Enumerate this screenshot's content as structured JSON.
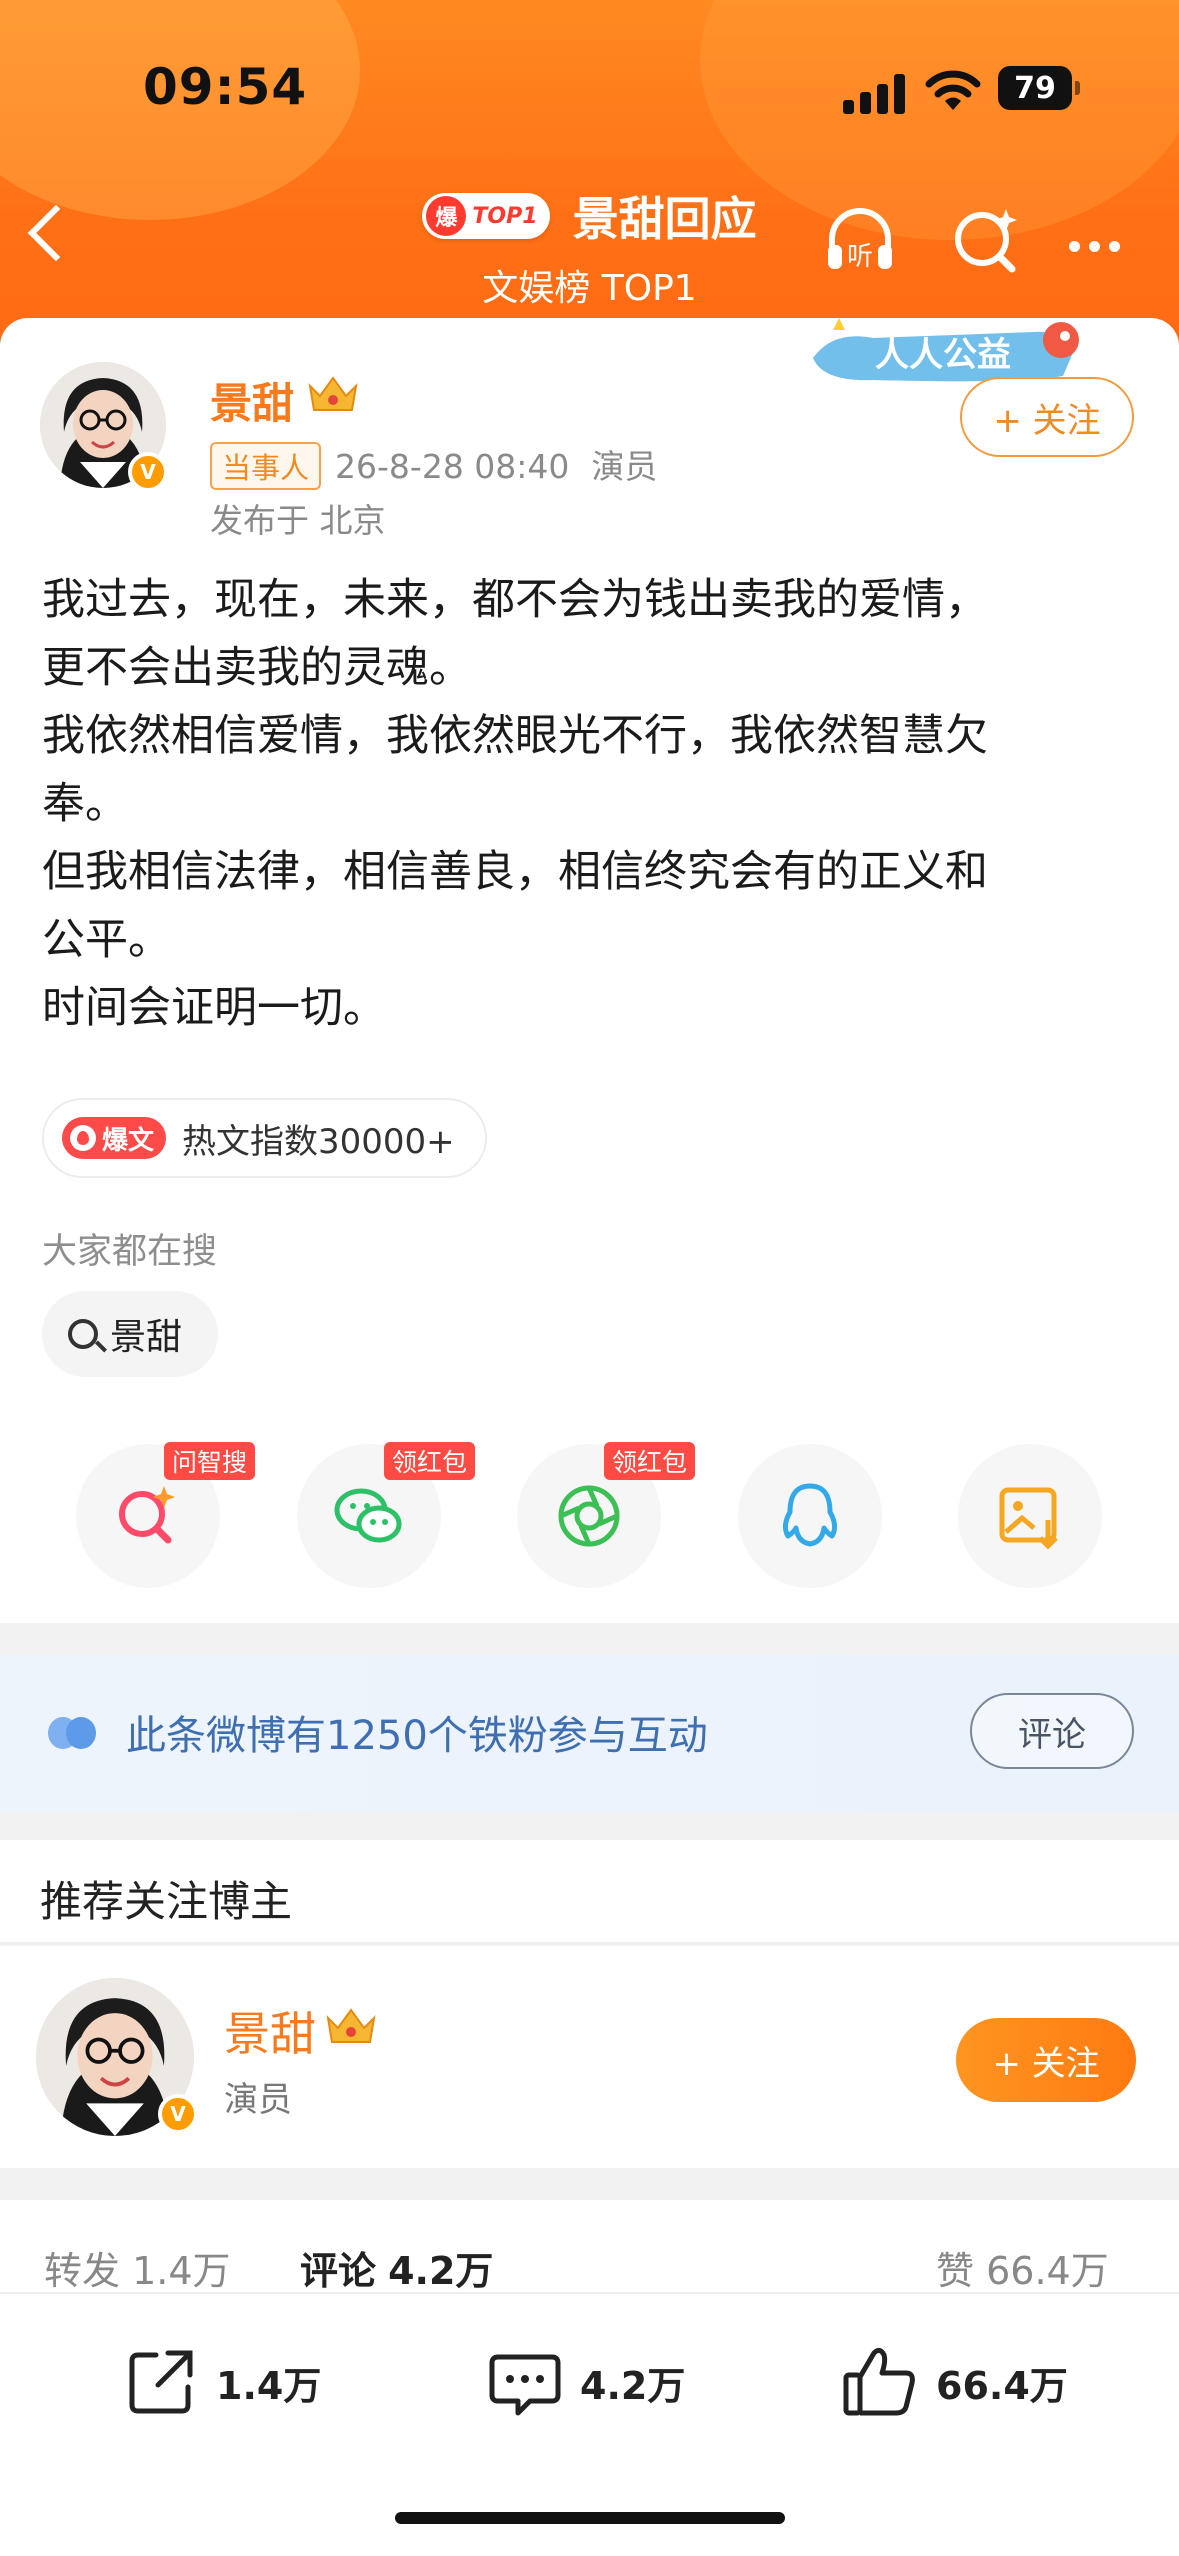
{
  "status_bar": {
    "time": "09:54",
    "battery": "79"
  },
  "nav": {
    "badge_bao": "爆",
    "badge_top": "TOP1",
    "title": "景甜回应",
    "subtitle": "文娱榜 TOP1",
    "icons": [
      "back-icon",
      "listen-icon",
      "search-icon",
      "more-icon"
    ],
    "listen_label": "听"
  },
  "post": {
    "author": "景甜",
    "role_tag": "当事人",
    "timestamp": "26-8-28 08:40",
    "role": "演员",
    "location": "发布于 北京",
    "follow_label": "+ 关注",
    "charity_label": "人人公益",
    "body_lines": [
      "我过去，现在，未来，都不会为钱出卖我的爱情，",
      "更不会出卖我的灵魂。",
      "我依然相信爱情，我依然眼光不行，我依然智慧欠",
      "奉。",
      "但我相信法律，相信善良，相信终究会有的正义和",
      "公平。",
      "时间会证明一切。"
    ],
    "hot_badge": "爆文",
    "hot_text": "热文指数30000+",
    "search_label": "大家都在搜",
    "search_chip": "景甜"
  },
  "share": {
    "buttons": [
      {
        "icon": "ai-search-icon",
        "tag": "问智搜"
      },
      {
        "icon": "wechat-icon",
        "tag": "领红包"
      },
      {
        "icon": "moments-icon",
        "tag": "领红包"
      },
      {
        "icon": "qq-icon",
        "tag": ""
      },
      {
        "icon": "save-image-icon",
        "tag": ""
      }
    ]
  },
  "fans": {
    "text": "此条微博有1250个铁粉参与互动",
    "comment_label": "评论"
  },
  "recommend": {
    "title": "推荐关注博主",
    "name": "景甜",
    "role": "演员",
    "follow_label": "+ 关注"
  },
  "stats": {
    "repost_label": "转发",
    "repost_value": "1.4万",
    "comment_label": "评论",
    "comment_value": "4.2万",
    "like_label": "赞",
    "like_value": "66.4万"
  },
  "actions": {
    "repost": "1.4万",
    "comment": "4.2万",
    "like": "66.4万"
  },
  "colors": {
    "brand_orange": "#ff7a12",
    "name_orange": "#f77b1e",
    "link_blue": "#3f6fb0"
  }
}
